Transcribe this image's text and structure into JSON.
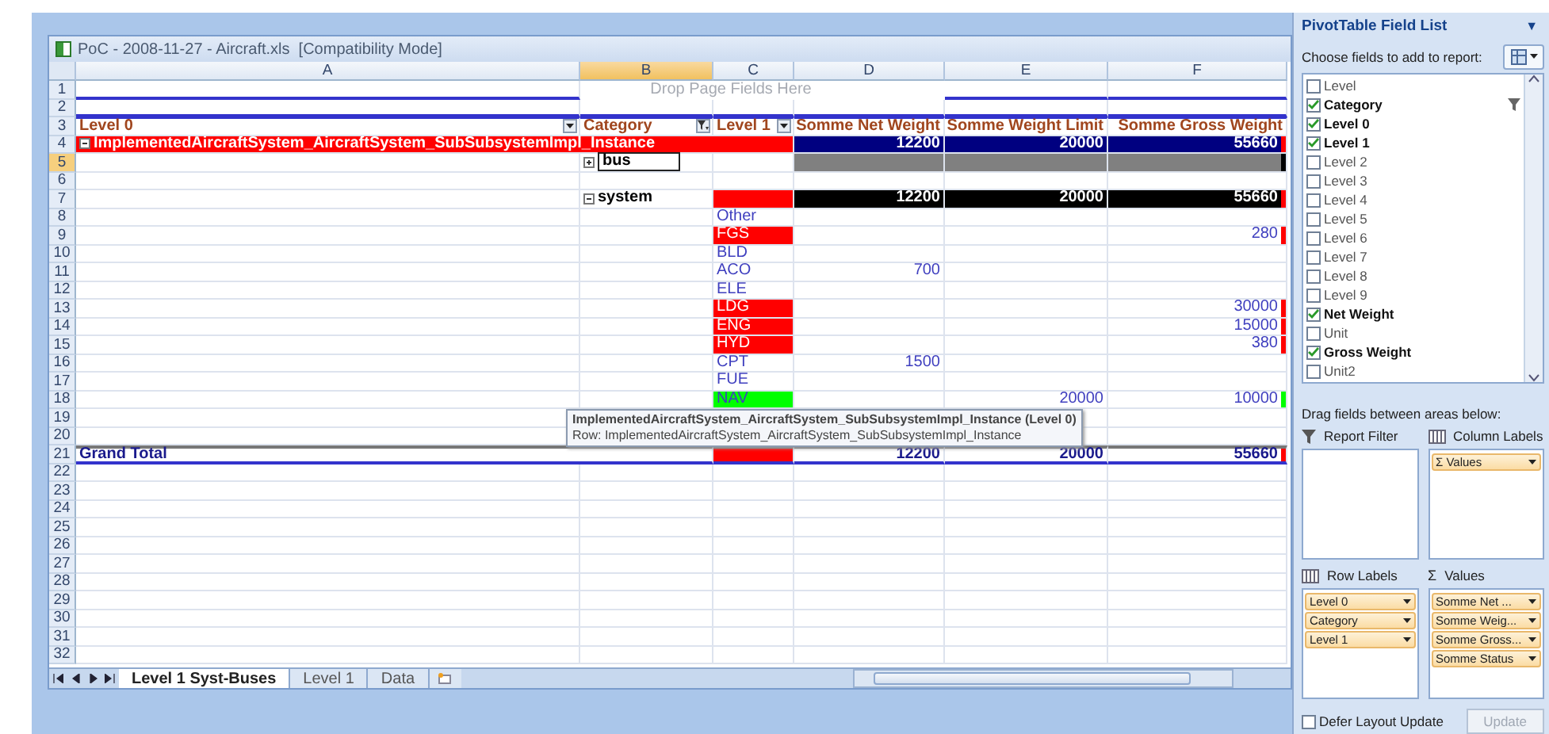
{
  "window": {
    "title": "PoC - 2008-11-27 - Aircraft.xls  [Compatibility Mode]"
  },
  "sheet": {
    "columns": [
      {
        "label": "A",
        "selected": false
      },
      {
        "label": "B",
        "selected": true
      },
      {
        "label": "C",
        "selected": false
      },
      {
        "label": "D",
        "selected": false
      },
      {
        "label": "E",
        "selected": false
      },
      {
        "label": "F",
        "selected": false
      }
    ],
    "drop_hint": "Drop Page Fields Here",
    "rows": [
      {
        "number": "1",
        "kind": "page",
        "selected": false
      },
      {
        "number": "2",
        "kind": "page",
        "selected": false
      },
      {
        "number": "3",
        "kind": "header",
        "selected": false,
        "a": {
          "text": "Level 0",
          "has_dropdown": true
        },
        "b": {
          "text": "Category",
          "has_dropdown": true,
          "filtered": true
        },
        "c": {
          "text": "Level 1",
          "has_dropdown": true
        },
        "d": {
          "text": "Somme Net Weight"
        },
        "e": {
          "text": "Somme Weight Limit"
        },
        "f": {
          "text": "Somme Gross Weight"
        }
      },
      {
        "number": "4",
        "kind": "group",
        "selected": false,
        "a": {
          "text": "ImplementedAircraftSystem_AircraftSystem_SubSubsystemImpl_Instance",
          "color": "#ff0000",
          "expanded": true
        },
        "d": {
          "text": "12200",
          "color": "#000080"
        },
        "e": {
          "text": "20000",
          "color": "#000080"
        },
        "f": {
          "text": "55660",
          "color": "#000080",
          "marker": {
            "color": "#ff0000"
          }
        }
      },
      {
        "number": "5",
        "kind": "group",
        "selected": true,
        "b": {
          "text": "bus",
          "expanded": false,
          "selected": true
        },
        "d": {
          "color": "#808080"
        },
        "e": {
          "color": "#808080"
        },
        "f": {
          "color": "#808080",
          "marker": {
            "color": "#000000"
          }
        }
      },
      {
        "number": "6",
        "kind": "plain",
        "selected": false
      },
      {
        "number": "7",
        "kind": "group",
        "selected": false,
        "b": {
          "text": "system",
          "expanded": true
        },
        "c": {
          "color": "#ff0000"
        },
        "d": {
          "text": "12200",
          "color": "#000000"
        },
        "e": {
          "text": "20000",
          "color": "#000000"
        },
        "f": {
          "text": "55660",
          "color": "#000000",
          "marker": {
            "color": "#ff0000"
          }
        }
      },
      {
        "number": "8",
        "kind": "item",
        "selected": false,
        "c": {
          "text": "Other"
        }
      },
      {
        "number": "9",
        "kind": "item",
        "selected": false,
        "c": {
          "text": "FGS",
          "color": "#ff0000"
        },
        "f": {
          "text": "280",
          "marker": {
            "color": "#ff0000"
          }
        }
      },
      {
        "number": "10",
        "kind": "item",
        "selected": false,
        "c": {
          "text": "BLD"
        }
      },
      {
        "number": "11",
        "kind": "item",
        "selected": false,
        "c": {
          "text": "ACO"
        },
        "d": {
          "text": "700"
        }
      },
      {
        "number": "12",
        "kind": "item",
        "selected": false,
        "c": {
          "text": "ELE"
        }
      },
      {
        "number": "13",
        "kind": "item",
        "selected": false,
        "c": {
          "text": "LDG",
          "color": "#ff0000"
        },
        "f": {
          "text": "30000",
          "marker": {
            "color": "#ff0000"
          }
        }
      },
      {
        "number": "14",
        "kind": "item",
        "selected": false,
        "c": {
          "text": "ENG",
          "color": "#ff0000"
        },
        "f": {
          "text": "15000",
          "marker": {
            "color": "#ff0000"
          }
        }
      },
      {
        "number": "15",
        "kind": "item",
        "selected": false,
        "c": {
          "text": "HYD",
          "color": "#ff0000"
        },
        "f": {
          "text": "380",
          "marker": {
            "color": "#ff0000"
          }
        }
      },
      {
        "number": "16",
        "kind": "item",
        "selected": false,
        "c": {
          "text": "CPT"
        },
        "d": {
          "text": "1500"
        }
      },
      {
        "number": "17",
        "kind": "item",
        "selected": false,
        "c": {
          "text": "FUE"
        }
      },
      {
        "number": "18",
        "kind": "item",
        "selected": false,
        "c": {
          "text": "NAV",
          "color": "#00ff00"
        },
        "e": {
          "text": "20000"
        },
        "f": {
          "text": "10000",
          "marker": {
            "color": "#00ff00"
          }
        }
      },
      {
        "number": "19",
        "kind": "plain",
        "selected": false
      },
      {
        "number": "20",
        "kind": "plain",
        "selected": false
      },
      {
        "number": "21",
        "kind": "total",
        "selected": false,
        "a": {
          "text": "Grand Total"
        },
        "c": {
          "color": "#ff0000"
        },
        "d": {
          "text": "12200"
        },
        "e": {
          "text": "20000"
        },
        "f": {
          "text": "55660",
          "marker": {
            "color": "#ff0000"
          }
        }
      },
      {
        "number": "22",
        "kind": "plain",
        "selected": false
      },
      {
        "number": "23",
        "kind": "plain",
        "selected": false
      },
      {
        "number": "24",
        "kind": "plain",
        "selected": false
      },
      {
        "number": "25",
        "kind": "plain",
        "selected": false
      },
      {
        "number": "26",
        "kind": "plain",
        "selected": false
      },
      {
        "number": "27",
        "kind": "plain",
        "selected": false
      },
      {
        "number": "28",
        "kind": "plain",
        "selected": false
      },
      {
        "number": "29",
        "kind": "plain",
        "selected": false
      },
      {
        "number": "30",
        "kind": "plain",
        "selected": false
      },
      {
        "number": "31",
        "kind": "plain",
        "selected": false
      },
      {
        "number": "32",
        "kind": "plain",
        "selected": false
      }
    ],
    "tooltip": {
      "lines": [
        "ImplementedAircraftSystem_AircraftSystem_SubSubsystemImpl_Instance (Level 0)",
        "Row: ImplementedAircraftSystem_AircraftSystem_SubSubsystemImpl_Instance"
      ]
    }
  },
  "sheet_tabs": [
    {
      "label": "Level 1 Syst-Buses",
      "selected": true
    },
    {
      "label": "Level 1",
      "selected": false
    },
    {
      "label": "Data",
      "selected": false
    }
  ],
  "field_list": {
    "title": "PivotTable Field List",
    "menu_arrow": "▼",
    "choose_label": "Choose fields to add to report:",
    "fields": [
      {
        "label": "Level",
        "checked": false,
        "filtered": false
      },
      {
        "label": "Category",
        "checked": true,
        "filtered": true
      },
      {
        "label": "Level 0",
        "checked": true,
        "filtered": false
      },
      {
        "label": "Level 1",
        "checked": true,
        "filtered": false
      },
      {
        "label": "Level 2",
        "checked": false,
        "filtered": false
      },
      {
        "label": "Level 3",
        "checked": false,
        "filtered": false
      },
      {
        "label": "Level 4",
        "checked": false,
        "filtered": false
      },
      {
        "label": "Level 5",
        "checked": false,
        "filtered": false
      },
      {
        "label": "Level 6",
        "checked": false,
        "filtered": false
      },
      {
        "label": "Level 7",
        "checked": false,
        "filtered": false
      },
      {
        "label": "Level 8",
        "checked": false,
        "filtered": false
      },
      {
        "label": "Level 9",
        "checked": false,
        "filtered": false
      },
      {
        "label": "Net Weight",
        "checked": true,
        "filtered": false
      },
      {
        "label": "Unit",
        "checked": false,
        "filtered": false
      },
      {
        "label": "Gross Weight",
        "checked": true,
        "filtered": false
      },
      {
        "label": "Unit2",
        "checked": false,
        "filtered": false
      }
    ],
    "drag_label": "Drag fields between areas below:",
    "areas": [
      {
        "kind": "filter",
        "title": "Report Filter"
      },
      {
        "kind": "columns",
        "title": "Column Labels",
        "items": [
          {
            "symbol": "Σ",
            "label": "Values"
          }
        ]
      },
      {
        "kind": "rows",
        "title": "Row Labels",
        "items": [
          {
            "label": "Level 0"
          },
          {
            "label": "Category"
          },
          {
            "label": "Level 1"
          }
        ]
      },
      {
        "kind": "values",
        "symbol": "Σ",
        "title": "Values",
        "items": [
          {
            "label": "Somme Net ..."
          },
          {
            "label": "Somme Weig..."
          },
          {
            "label": "Somme Gross..."
          },
          {
            "label": "Somme Status"
          }
        ]
      }
    ],
    "defer": {
      "label": "Defer Layout Update",
      "checked": false
    },
    "update": {
      "label": "Update",
      "disabled": true
    }
  }
}
